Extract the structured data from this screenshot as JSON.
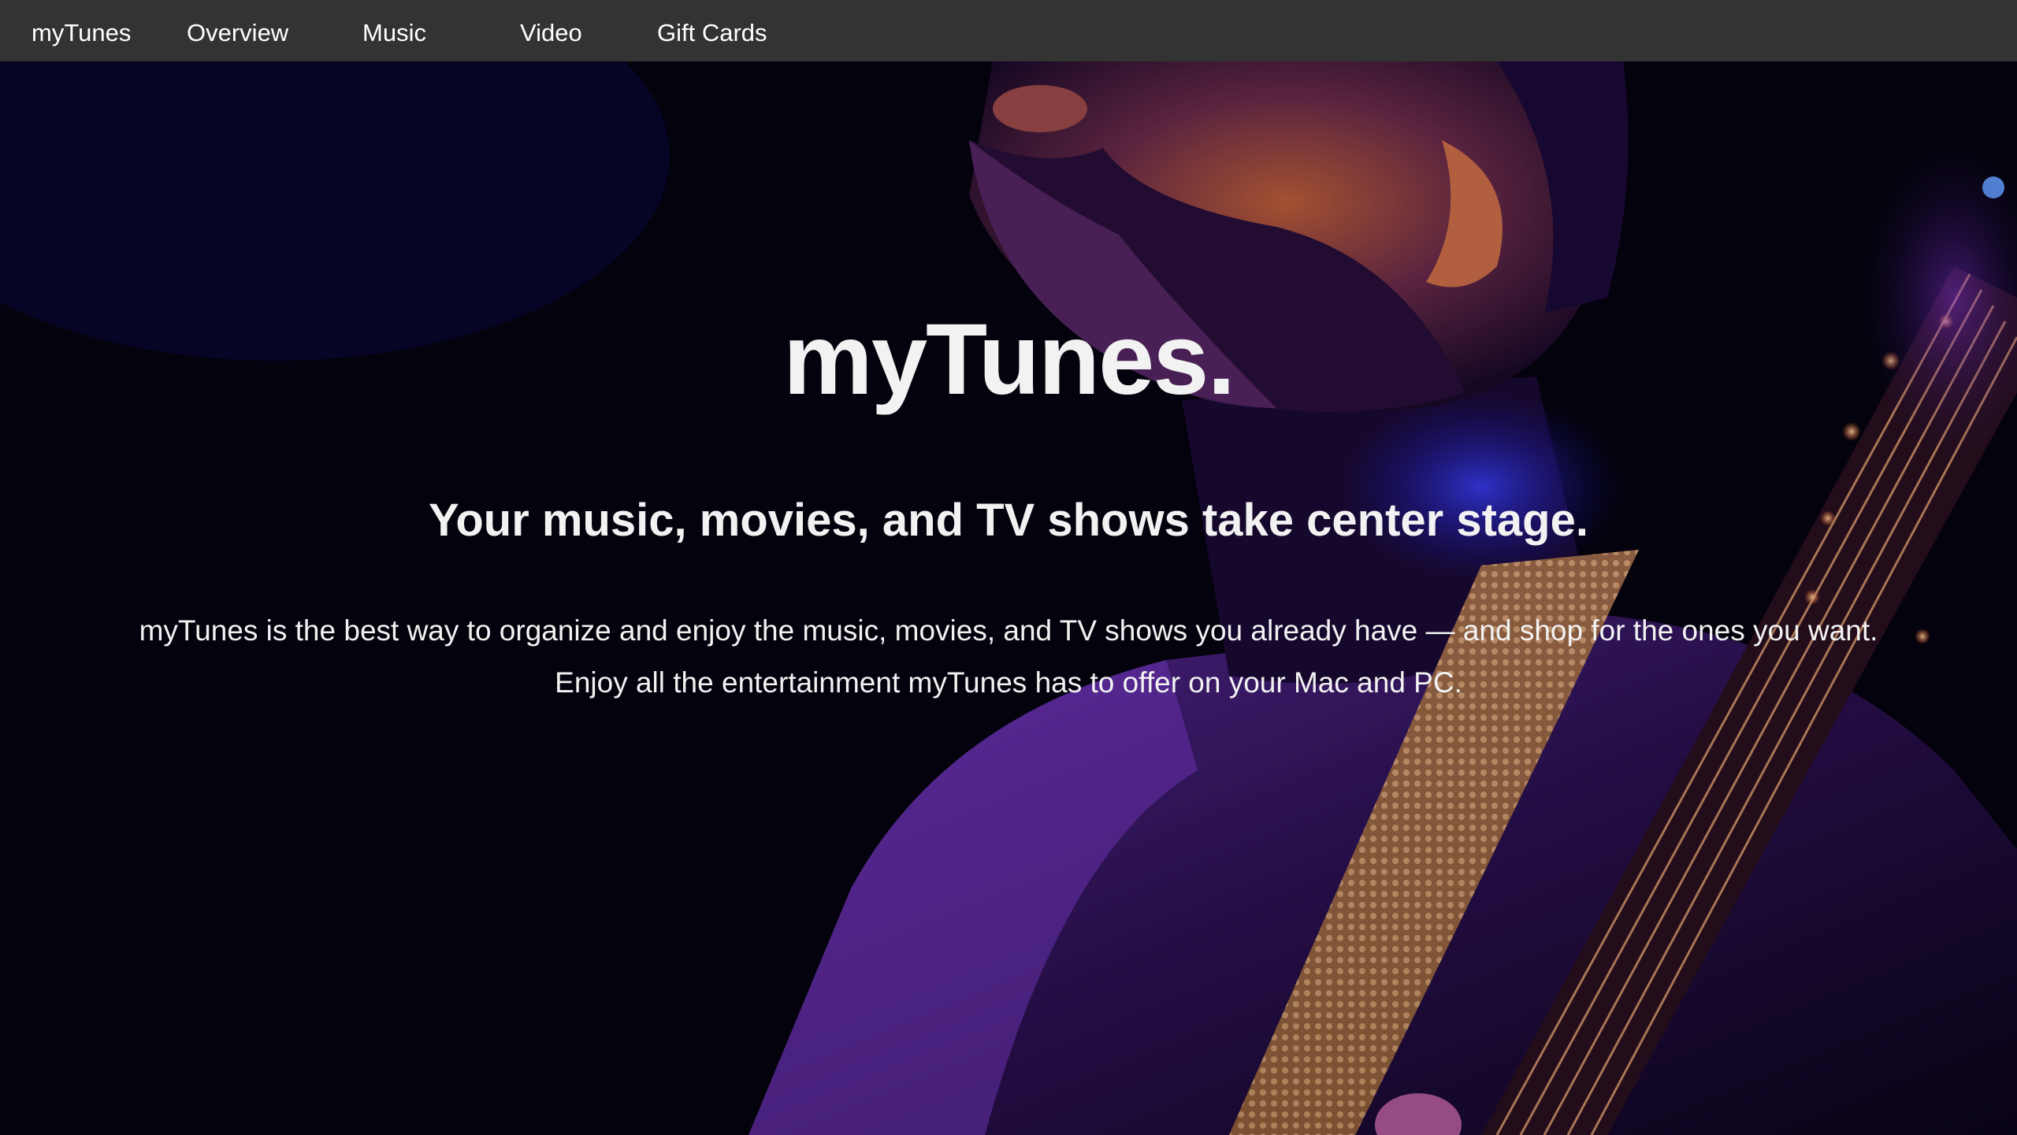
{
  "nav": {
    "brand": "myTunes",
    "items": [
      {
        "label": "Overview"
      },
      {
        "label": "Music"
      },
      {
        "label": "Video"
      },
      {
        "label": "Gift Cards"
      }
    ]
  },
  "hero": {
    "title": "myTunes.",
    "subtitle": "Your music, movies, and TV shows take center stage.",
    "description_lines": [
      "myTunes is the best way to organize and enjoy the music, movies, and TV shows you already have — and shop for the ones you want.",
      "Enjoy all the entertainment myTunes has to offer on your Mac and PC."
    ]
  },
  "colors": {
    "navbar": "#333333",
    "nav_text": "#ffffff",
    "hero_text": "#f2f2f2",
    "accent_purple": "#7a2fd6",
    "accent_blue": "#2a3cff",
    "accent_orange": "#e08a5a"
  }
}
